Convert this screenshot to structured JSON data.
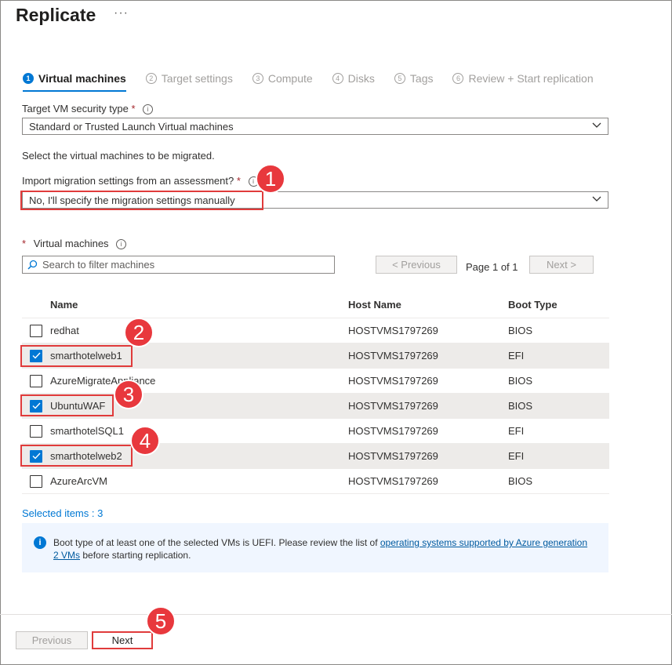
{
  "page": {
    "title": "Replicate",
    "more": "···"
  },
  "steps": [
    {
      "num": "1",
      "label": "Virtual machines"
    },
    {
      "num": "2",
      "label": "Target settings"
    },
    {
      "num": "3",
      "label": "Compute"
    },
    {
      "num": "4",
      "label": "Disks"
    },
    {
      "num": "5",
      "label": "Tags"
    },
    {
      "num": "6",
      "label": "Review + Start replication"
    }
  ],
  "form": {
    "security_label": "Target VM security type",
    "security_value": "Standard or Trusted Launch Virtual machines",
    "select_text": "Select the virtual machines to be migrated.",
    "import_label": "Import migration settings from an assessment?",
    "import_value": "No, I'll specify the migration settings manually",
    "required": "*",
    "info": "i"
  },
  "vm_section": {
    "label": "Virtual machines",
    "search_placeholder": "Search to filter machines",
    "prev_label": "< Previous",
    "page_info": "Page 1 of 1",
    "next_label": "Next >"
  },
  "table": {
    "headers": [
      "Name",
      "Host Name",
      "Boot Type"
    ],
    "rows": [
      {
        "name": "redhat",
        "host": "HOSTVMS1797269",
        "boot": "BIOS",
        "checked": false
      },
      {
        "name": "smarthotelweb1",
        "host": "HOSTVMS1797269",
        "boot": "EFI",
        "checked": true
      },
      {
        "name": "AzureMigrateAppliance",
        "host": "HOSTVMS1797269",
        "boot": "BIOS",
        "checked": false
      },
      {
        "name": "UbuntuWAF",
        "host": "HOSTVMS1797269",
        "boot": "BIOS",
        "checked": true
      },
      {
        "name": "smarthotelSQL1",
        "host": "HOSTVMS1797269",
        "boot": "EFI",
        "checked": false
      },
      {
        "name": "smarthotelweb2",
        "host": "HOSTVMS1797269",
        "boot": "EFI",
        "checked": true
      },
      {
        "name": "AzureArcVM",
        "host": "HOSTVMS1797269",
        "boot": "BIOS",
        "checked": false
      }
    ]
  },
  "selected_count": "Selected items : 3",
  "notice": {
    "text_before": "Boot type of at least one of the selected VMs is UEFI. Please review the list of ",
    "link": "operating systems supported by Azure generation 2 VMs",
    "text_after": " before starting replication."
  },
  "footer": {
    "previous": "Previous",
    "next": "Next"
  },
  "callouts": [
    "1",
    "2",
    "3",
    "4",
    "5"
  ],
  "colors": {
    "accent": "#0078d4",
    "highlight": "#e03b3b",
    "selected_row": "#edebe9",
    "info_bg": "#f0f6ff"
  }
}
